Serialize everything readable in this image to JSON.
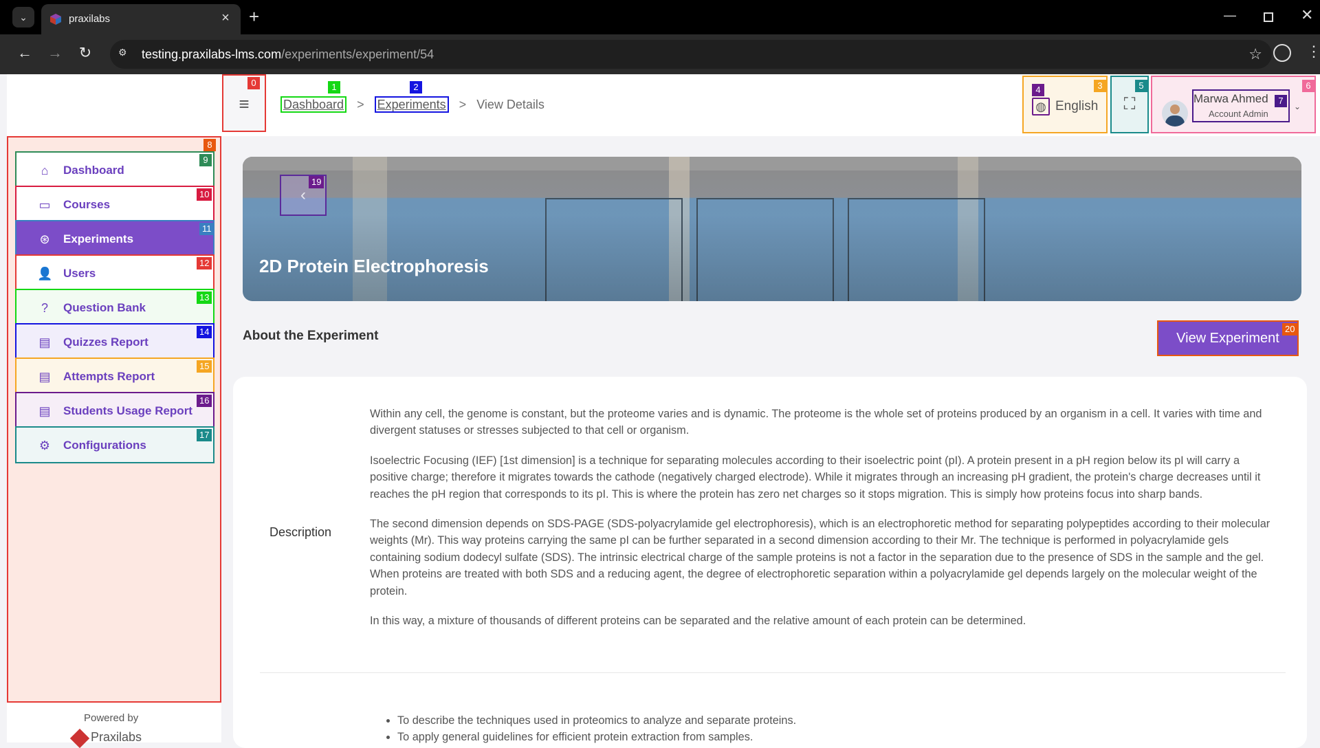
{
  "browser": {
    "tab_title": "praxilabs",
    "url_domain": "testing.praxilabs-lms.com",
    "url_path": "/experiments/experiment/54"
  },
  "topbar": {
    "breadcrumb": [
      "Dashboard",
      "Experiments",
      "View Details"
    ],
    "language": "English",
    "user_name": "Marwa Ahmed",
    "user_role": "Account Admin"
  },
  "sidebar": {
    "items": [
      {
        "label": "Dashboard",
        "icon": "home-icon"
      },
      {
        "label": "Courses",
        "icon": "book-icon"
      },
      {
        "label": "Experiments",
        "icon": "aperture-icon"
      },
      {
        "label": "Users",
        "icon": "user-icon"
      },
      {
        "label": "Question Bank",
        "icon": "question-icon"
      },
      {
        "label": "Quizzes Report",
        "icon": "report-icon"
      },
      {
        "label": "Attempts Report",
        "icon": "report-icon"
      },
      {
        "label": "Students Usage Report",
        "icon": "report-icon"
      },
      {
        "label": "Configurations",
        "icon": "gear-icon"
      }
    ],
    "powered_by": "Powered by",
    "logo_text": "Praxilabs"
  },
  "hero": {
    "title": "2D Protein Electrophoresis"
  },
  "about": {
    "title": "About the Experiment",
    "view_button": "View Experiment",
    "description_label": "Description",
    "paragraphs": [
      "Within any cell, the genome is constant, but the proteome varies and is dynamic. The proteome is the whole set of proteins produced by an organism in a cell. It varies with time and divergent statuses or stresses subjected to that cell or organism.",
      "Isoelectric Focusing (IEF) [1st dimension] is a technique for separating molecules according to their isoelectric point (pI). A protein present in a pH region below its pI will carry a positive charge; therefore it migrates towards the cathode (negatively charged electrode). While it migrates through an increasing pH gradient, the protein's charge decreases until it reaches the pH region that corresponds to its pI. This is where the protein has zero net charges so it stops migration. This is simply how proteins focus into sharp bands.",
      "The second dimension depends on SDS-PAGE (SDS-polyacrylamide gel electrophoresis), which is an electrophoretic method for separating polypeptides according to their molecular weights (Mr). This way proteins carrying the same pI can be further separated in a second dimension according to their Mr. The technique is performed in polyacrylamide gels containing sodium dodecyl sulfate (SDS). The intrinsic electrical charge of the sample proteins is not a factor in the separation due to the presence of SDS in the sample and the gel. When proteins are treated with both SDS and a reducing agent, the degree of electrophoretic separation within a polyacrylamide gel depends largely on the molecular weight of the protein.",
      "In this way, a mixture of thousands of different proteins can be separated and the relative amount of each protein can be determined."
    ],
    "objectives": [
      "To describe the techniques used in proteomics to analyze and separate proteins.",
      "To apply general guidelines for efficient protein extraction from samples."
    ]
  },
  "badges": [
    "0",
    "1",
    "2",
    "3",
    "4",
    "5",
    "6",
    "7",
    "8",
    "9",
    "10",
    "11",
    "12",
    "13",
    "14",
    "15",
    "16",
    "17",
    "19",
    "20"
  ],
  "colors": {
    "accent_purple": "#7c4dc8",
    "sidebar_bg": "#fde8e2",
    "marker_red": "#e53935"
  }
}
